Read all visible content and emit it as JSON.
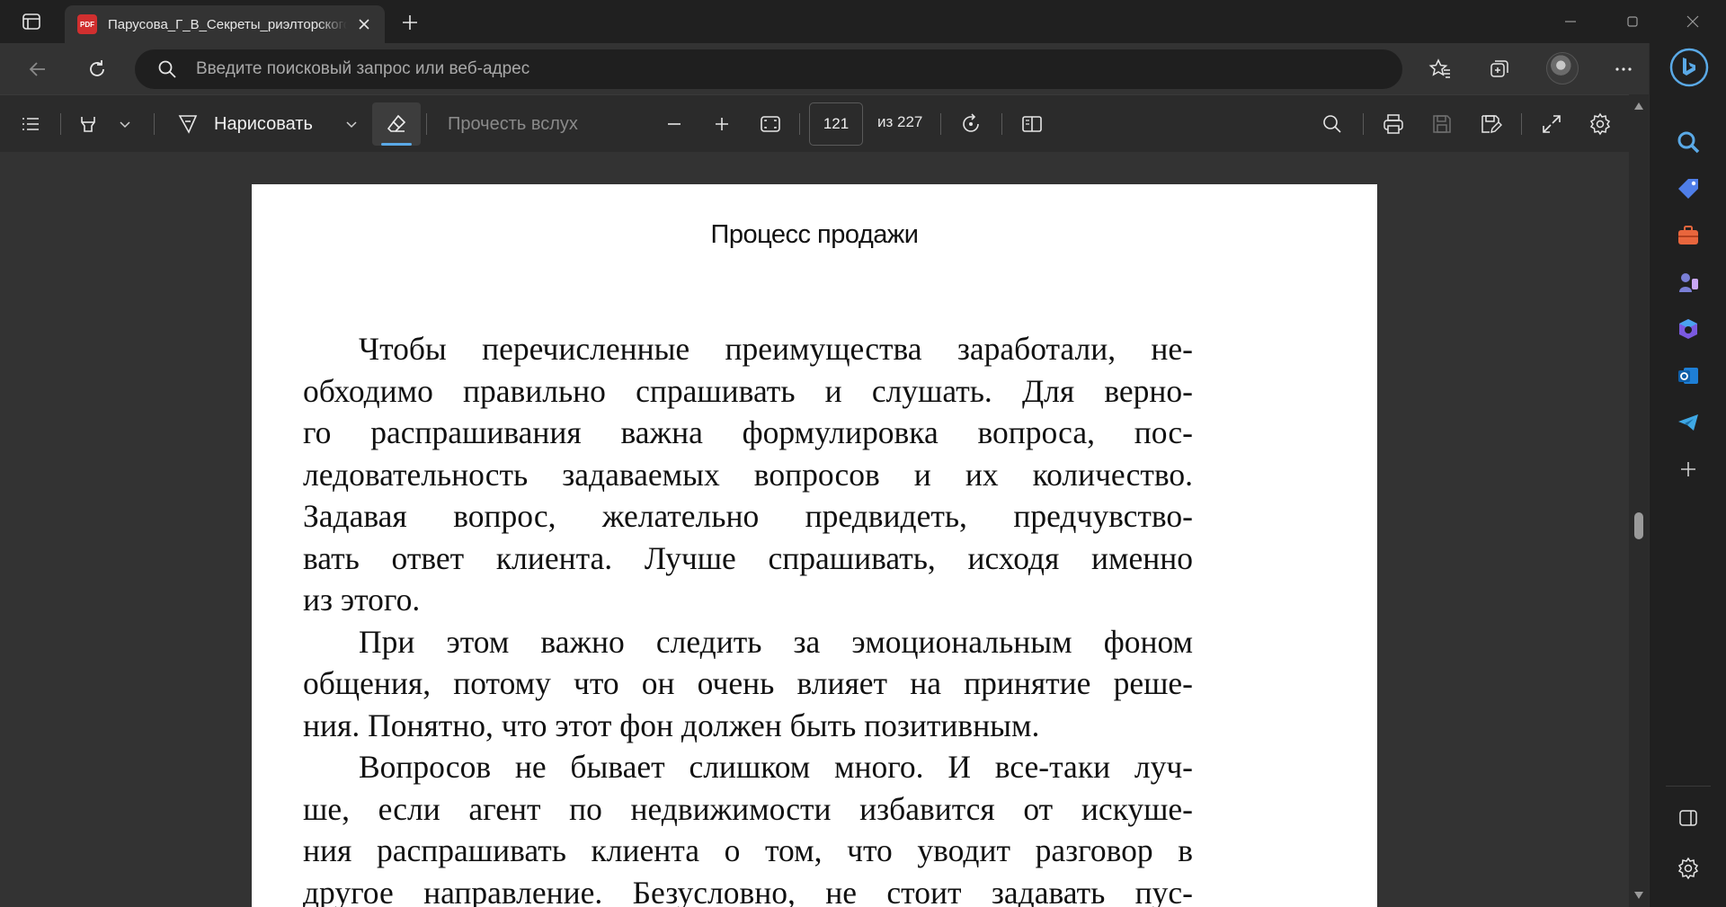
{
  "tab": {
    "title": "Парусова_Г_В_Секреты_риэлторского_бизнеса",
    "badge": "PDF"
  },
  "addressbar": {
    "placeholder": "Введите поисковый запрос или веб-адрес"
  },
  "pdf_toolbar": {
    "draw_label": "Нарисовать",
    "read_aloud_label": "Прочесть вслух",
    "page_current": "121",
    "page_total_label": "из 227"
  },
  "document": {
    "running_head": "Процесс продажи",
    "paragraphs": [
      {
        "lines": [
          "Чтобы перечисленные преимущества заработали, не-",
          "обходимо правильно спрашивать и слушать. Для верно-",
          "го распрашивания важна формулировка вопроса, пос-",
          "ледовательность задаваемых вопросов и их количество.",
          "Задавая вопрос, желательно предвидеть, предчувство-",
          "вать ответ клиента. Лучше спрашивать, исходя именно",
          "из этого."
        ]
      },
      {
        "lines": [
          "При этом важно следить за эмоциональным фоном",
          "общения, потому что он очень влияет на принятие реше-",
          "ния. Понятно, что этот фон должен быть позитивным."
        ]
      },
      {
        "lines": [
          "Вопросов не бывает слишком много. И все-таки луч-",
          "ше, если агент по недвижимости избавится от искуше-",
          "ния распрашивать клиента о том, что уводит разговор в",
          "другое направление. Безусловно, не стоит задавать пус-"
        ]
      }
    ]
  },
  "colors": {
    "accent": "#5aa9e6",
    "pdf_badge": "#d12f2f"
  },
  "icons": {
    "sidebar": [
      "search-icon",
      "shopping-tag-icon",
      "tools-icon",
      "games-icon",
      "office-icon",
      "outlook-icon",
      "telegram-icon",
      "add-icon",
      "sidebar-toggle-icon",
      "settings-icon"
    ]
  }
}
